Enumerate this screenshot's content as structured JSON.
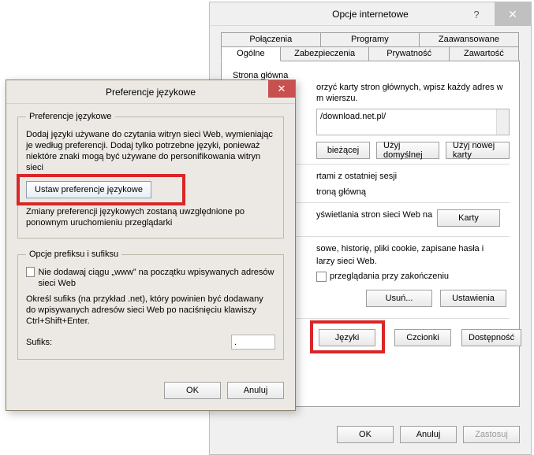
{
  "io": {
    "title": "Opcje internetowe",
    "help": "?",
    "close": "✕",
    "tabs_row1": [
      "Połączenia",
      "Programy",
      "Zaawansowane"
    ],
    "tabs_row2": [
      "Ogólne",
      "Zabezpieczenia",
      "Prywatność",
      "Zawartość"
    ],
    "active_tab": "Ogólne",
    "home": {
      "heading": "Strona główna",
      "desc_l1": "orzyć karty stron głównych, wpisz każdy adres w",
      "desc_l2": "m wierszu.",
      "url": "/download.net.pl/",
      "btn_current": "bieżącej",
      "btn_default": "Użyj domyślnej",
      "btn_newtab": "Użyj nowej karty"
    },
    "startup": {
      "opt1": "rtami z ostatniej sesji",
      "opt2": "troną główną"
    },
    "tabs_section": {
      "text": "yświetlania stron sieci Web na",
      "btn": "Karty"
    },
    "history": {
      "line1": "sowe, historię, pliki cookie, zapisane hasła i",
      "line2": "larzy sieci Web.",
      "chk": "przeglądania przy zakończeniu",
      "btn_del": "Usuń...",
      "btn_set": "Ustawienia"
    },
    "appearance": {
      "btn_lang": "Języki",
      "btn_fonts": "Czcionki",
      "btn_acc": "Dostępność"
    },
    "footer": {
      "ok": "OK",
      "cancel": "Anuluj",
      "apply": "Zastosuj"
    }
  },
  "lang": {
    "title": "Preferencje językowe",
    "close": "✕",
    "group1_legend": "Preferencje językowe",
    "group1_desc": "Dodaj języki używane do czytania witryn sieci Web, wymieniając je według preferencji. Dodaj tylko potrzebne języki, ponieważ niektóre znaki mogą być używane do personifikowania witryn sieci",
    "set_btn": "Ustaw preferencje językowe",
    "group1_note": "Zmiany preferencji językowych zostaną uwzględnione po ponownym uruchomieniu przeglądarki",
    "group2_legend": "Opcje prefiksu i sufiksu",
    "group2_chk": "Nie dodawaj ciągu „www” na początku wpisywanych adresów sieci Web",
    "group2_desc": "Określ sufiks (na przykład .net), który powinien być dodawany do wpisywanych adresów sieci Web po naciśnięciu klawiszy Ctrl+Shift+Enter.",
    "suffix_label": "Sufiks:",
    "suffix_value": ".",
    "footer": {
      "ok": "OK",
      "cancel": "Anuluj"
    }
  }
}
